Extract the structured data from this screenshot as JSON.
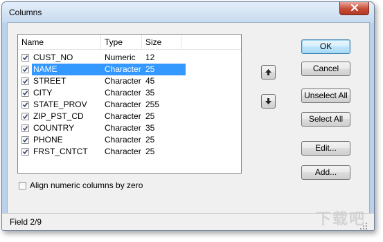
{
  "window": {
    "title": "Columns"
  },
  "columns_list": {
    "headers": [
      "Name",
      "Type",
      "Size"
    ],
    "rows": [
      {
        "name": "CUST_NO",
        "type": "Numeric",
        "size": "12",
        "checked": true,
        "selected": false
      },
      {
        "name": "NAME",
        "type": "Character",
        "size": "25",
        "checked": true,
        "selected": true
      },
      {
        "name": "STREET",
        "type": "Character",
        "size": "45",
        "checked": true,
        "selected": false
      },
      {
        "name": "CITY",
        "type": "Character",
        "size": "35",
        "checked": true,
        "selected": false
      },
      {
        "name": "STATE_PROV",
        "type": "Character",
        "size": "255",
        "checked": true,
        "selected": false
      },
      {
        "name": "ZIP_PST_CD",
        "type": "Character",
        "size": "25",
        "checked": true,
        "selected": false
      },
      {
        "name": "COUNTRY",
        "type": "Character",
        "size": "35",
        "checked": true,
        "selected": false
      },
      {
        "name": "PHONE",
        "type": "Character",
        "size": "25",
        "checked": true,
        "selected": false
      },
      {
        "name": "FRST_CNTCT",
        "type": "Character",
        "size": "25",
        "checked": true,
        "selected": false
      }
    ]
  },
  "move_buttons": {
    "up_icon": "arrow-up-icon",
    "down_icon": "arrow-down-icon"
  },
  "buttons": {
    "ok": "OK",
    "cancel": "Cancel",
    "unselect_all": "Unselect All",
    "select_all": "Select All",
    "edit": "Edit...",
    "add": "Add..."
  },
  "options": {
    "align_numeric_label": "Align numeric columns by zero",
    "align_numeric_checked": false
  },
  "status": {
    "text": "Field 2/9"
  },
  "watermark": {
    "text": "下载吧"
  },
  "colors": {
    "selection": "#3399ff",
    "frame": "#b9d1ea",
    "close": "#c74a36"
  }
}
